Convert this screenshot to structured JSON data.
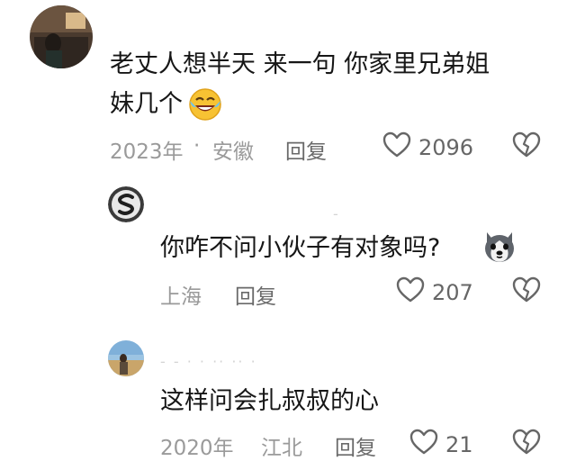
{
  "comments": [
    {
      "text_line1": "老丈人想半天 来一句 你家里兄弟姐",
      "text_line2": "妹几个",
      "emoji": "laughing-crying-face-icon",
      "date": "2023年",
      "location": "安徽",
      "separator": "·",
      "reply_label": "回复",
      "like_count": "2096"
    },
    {
      "username": "-",
      "text": "你咋不问小伙子有对象吗?",
      "emoji": "husky-dog-icon",
      "location": "上海",
      "reply_label": "回复",
      "like_count": "207"
    },
    {
      "username": "- -  ·  ·  ··  ··  ·",
      "text": "这样问会扎叔叔的心",
      "date": "2020年",
      "location": "江北",
      "reply_label": "回复",
      "like_count": "21"
    }
  ],
  "colors": {
    "accent_gray": "#9a9a9a",
    "text": "#161616",
    "emoji_yellow": "#f7c233"
  }
}
